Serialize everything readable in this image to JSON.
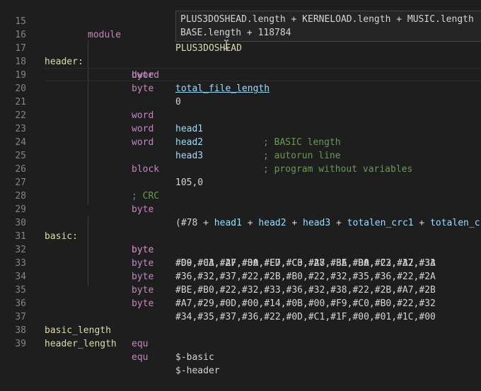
{
  "editor": {
    "lines": [
      {
        "n": "15"
      },
      {
        "n": "16"
      },
      {
        "n": "17"
      },
      {
        "n": "18"
      },
      {
        "n": "19"
      },
      {
        "n": "20"
      },
      {
        "n": "21"
      },
      {
        "n": "22"
      },
      {
        "n": "23"
      },
      {
        "n": "24"
      },
      {
        "n": "25"
      },
      {
        "n": "26"
      },
      {
        "n": "27"
      },
      {
        "n": "28"
      },
      {
        "n": "29"
      },
      {
        "n": "30"
      },
      {
        "n": "31"
      },
      {
        "n": "32"
      },
      {
        "n": "33"
      },
      {
        "n": "34"
      },
      {
        "n": "35"
      },
      {
        "n": "36"
      },
      {
        "n": "37"
      },
      {
        "n": "38"
      },
      {
        "n": "39"
      }
    ],
    "l15": {
      "kw": "module",
      "op": "PLUS3DOSHEAD"
    },
    "l17": {
      "label": "header:",
      "kw": "byte"
    },
    "l18": {
      "kw": "dword",
      "op": "total_file_length"
    },
    "l19": {
      "kw": "byte",
      "op": "0"
    },
    "l21": {
      "kw": "word",
      "op": "head1",
      "cm": "; BASIC length"
    },
    "l22": {
      "kw": "word",
      "op": "head2",
      "cm": "; autorun line"
    },
    "l23": {
      "kw": "word",
      "op": "head3",
      "cm": "; program without variables"
    },
    "l25": {
      "kw": "block",
      "op": "105,0"
    },
    "l27": {
      "cm": "; CRC"
    },
    "l28": {
      "kw": "byte",
      "op_parts": [
        "(#78",
        " + ",
        "head1",
        " + ",
        "head2",
        " + ",
        "head3",
        " + ",
        "totalen_crc1",
        " + ",
        "totalen_cr"
      ]
    },
    "l30": {
      "label": "basic:",
      "kw": "byte",
      "op": "#00,#0A,#2F,#00,#E7,#C3,#A7,#3A,#DA,#C3,#A7,#3A"
    },
    "l31": {
      "kw": "byte",
      "op": "#D9,#C3,#A7,#3A,#FD,#C0,#28,#BE,#B0,#22,#32,#33"
    },
    "l32": {
      "kw": "byte",
      "op": "#36,#32,#37,#22,#2B,#B0,#22,#32,#35,#36,#22,#2A"
    },
    "l33": {
      "kw": "byte",
      "op": "#BE,#B0,#22,#32,#33,#36,#32,#38,#22,#2B,#A7,#2B"
    },
    "l34": {
      "kw": "byte",
      "op": "#A7,#29,#0D,#00,#14,#0B,#00,#F9,#C0,#B0,#22,#32"
    },
    "l35": {
      "kw": "byte",
      "op": "#34,#35,#37,#36,#22,#0D,#C1,#1F,#00,#01,#1C,#00"
    },
    "l37": {
      "label": "basic_length",
      "kw": "equ",
      "op": "$-basic"
    },
    "l38": {
      "label": "header_length",
      "kw": "equ",
      "op": "$-header"
    }
  },
  "tooltip": {
    "line1": "PLUS3DOSHEAD.length + KERNELOAD.length + MUSIC.length",
    "line2": "BASE.length + 118784"
  },
  "colors": {
    "background": "#1e1e1e",
    "keyword": "#c586c0",
    "label": "#dcdcaa",
    "identifier": "#9cdcfe",
    "comment": "#6a9955",
    "line_number": "#858585"
  }
}
